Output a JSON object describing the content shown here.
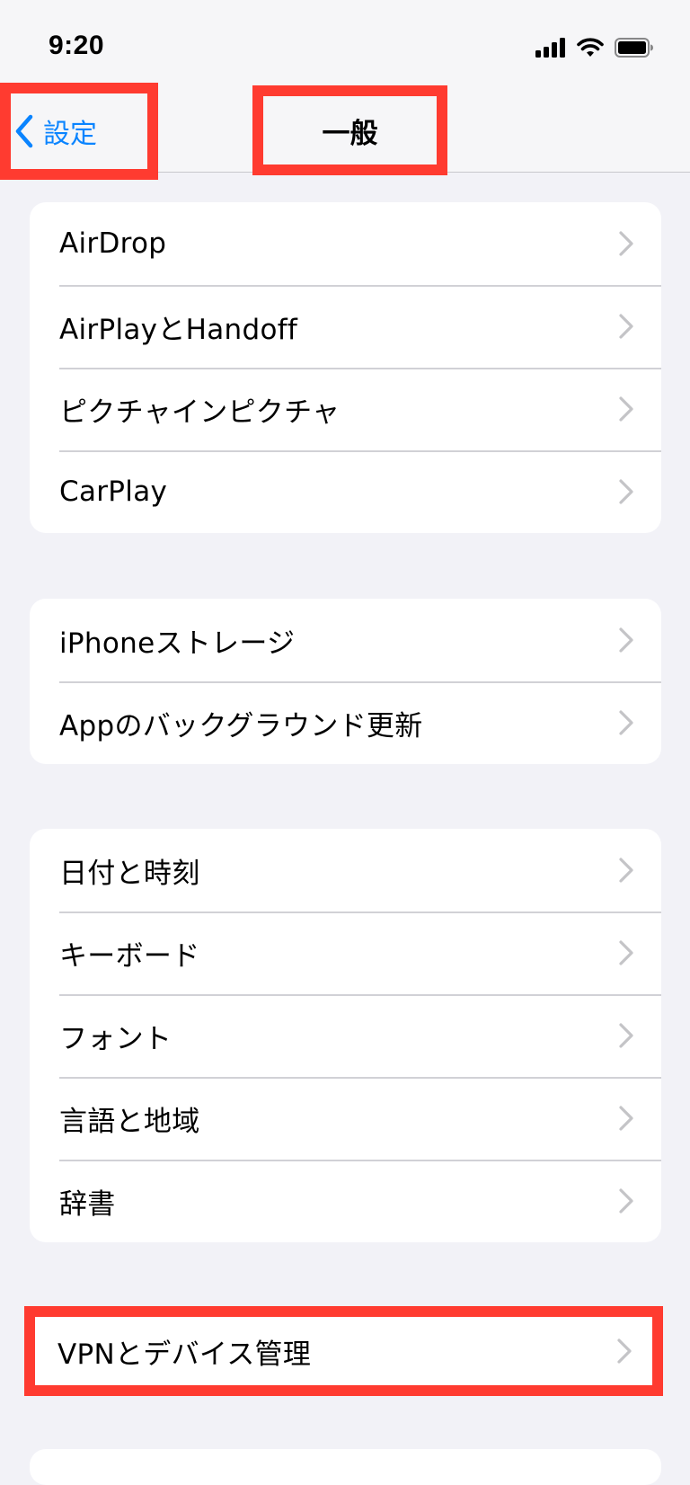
{
  "status_bar": {
    "time": "9:20",
    "icons": [
      "signal-icon",
      "wifi-icon",
      "battery-icon"
    ]
  },
  "nav": {
    "back_label": "設定",
    "title": "一般"
  },
  "groups": [
    {
      "items": [
        "AirDrop",
        "AirPlayとHandoff",
        "ピクチャインピクチャ",
        "CarPlay"
      ]
    },
    {
      "items": [
        "iPhoneストレージ",
        "Appのバックグラウンド更新"
      ]
    },
    {
      "items": [
        "日付と時刻",
        "キーボード",
        "フォント",
        "言語と地域",
        "辞書"
      ]
    },
    {
      "items": [
        "VPNとデバイス管理"
      ]
    }
  ],
  "colors": {
    "accent": "#007aff",
    "highlight": "#ff3b30",
    "background": "#f2f2f7",
    "chevron": "#c4c4c7"
  }
}
